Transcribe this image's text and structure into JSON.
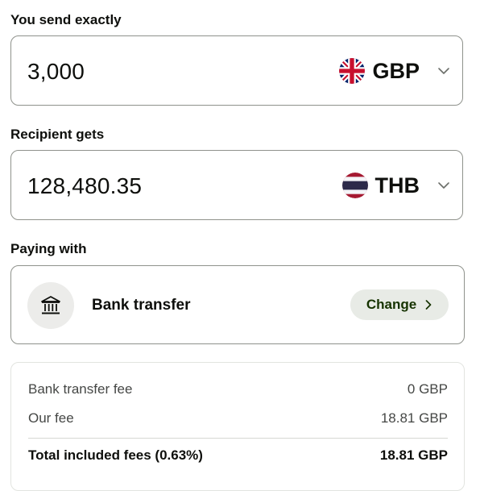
{
  "send": {
    "label": "You send exactly",
    "amount": "3,000",
    "currency": "GBP",
    "flag_icon": "uk-flag-icon"
  },
  "receive": {
    "label": "Recipient gets",
    "amount": "128,480.35",
    "currency": "THB",
    "flag_icon": "thailand-flag-icon"
  },
  "paying": {
    "label": "Paying with",
    "method": "Bank transfer",
    "icon": "bank-icon",
    "change_label": "Change"
  },
  "fees": {
    "rows": [
      {
        "label": "Bank transfer fee",
        "value": "0 GBP"
      },
      {
        "label": "Our fee",
        "value": "18.81 GBP"
      }
    ],
    "total": {
      "label": "Total included fees (0.63%)",
      "value": "18.81 GBP"
    }
  },
  "colors": {
    "border": "#8f928c",
    "change_bg": "#e8ebe6",
    "change_text": "#163300",
    "icon_bg": "#ececea"
  }
}
